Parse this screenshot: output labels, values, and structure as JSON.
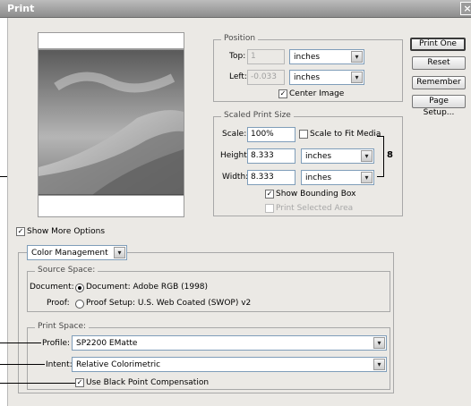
{
  "window": {
    "title": "Print",
    "close_glyph": "×"
  },
  "buttons": {
    "print_one": "Print One",
    "reset": "Reset",
    "remember": "Remember",
    "page_setup": "Page Setup..."
  },
  "position": {
    "legend": "Position",
    "top_label": "Top:",
    "top_value": "1",
    "top_unit": "inches",
    "left_label": "Left:",
    "left_value": "-0.033",
    "left_unit": "inches",
    "center_label": "Center Image",
    "center_checked": true
  },
  "scaled": {
    "legend": "Scaled Print Size",
    "scale_label": "Scale:",
    "scale_value": "100%",
    "fit_label": "Scale to Fit Media",
    "height_label": "Height:",
    "height_value": "8.333",
    "height_unit": "inches",
    "width_label": "Width:",
    "width_value": "8.333",
    "width_unit": "inches",
    "link_glyph": "8",
    "bounding_label": "Show Bounding Box",
    "bounding_checked": true,
    "selected_label": "Print Selected Area"
  },
  "more_options": {
    "label": "Show More Options",
    "checked": true
  },
  "color_mgmt": {
    "dropdown": "Color Management",
    "source_legend": "Source Space:",
    "document_label": "Document:",
    "document_option": "Document:  Adobe RGB (1998)",
    "proof_label": "Proof:",
    "proof_option": "Proof Setup:  U.S. Web Coated (SWOP) v2",
    "print_legend": "Print Space:",
    "profile_label": "Profile:",
    "profile_value": "SP2200 EMatte",
    "intent_label": "Intent:",
    "intent_value": "Relative Colorimetric",
    "bpc_label": "Use Black Point Compensation",
    "bpc_checked": true
  },
  "check_glyph": "✓",
  "arrow_glyph": "▾"
}
